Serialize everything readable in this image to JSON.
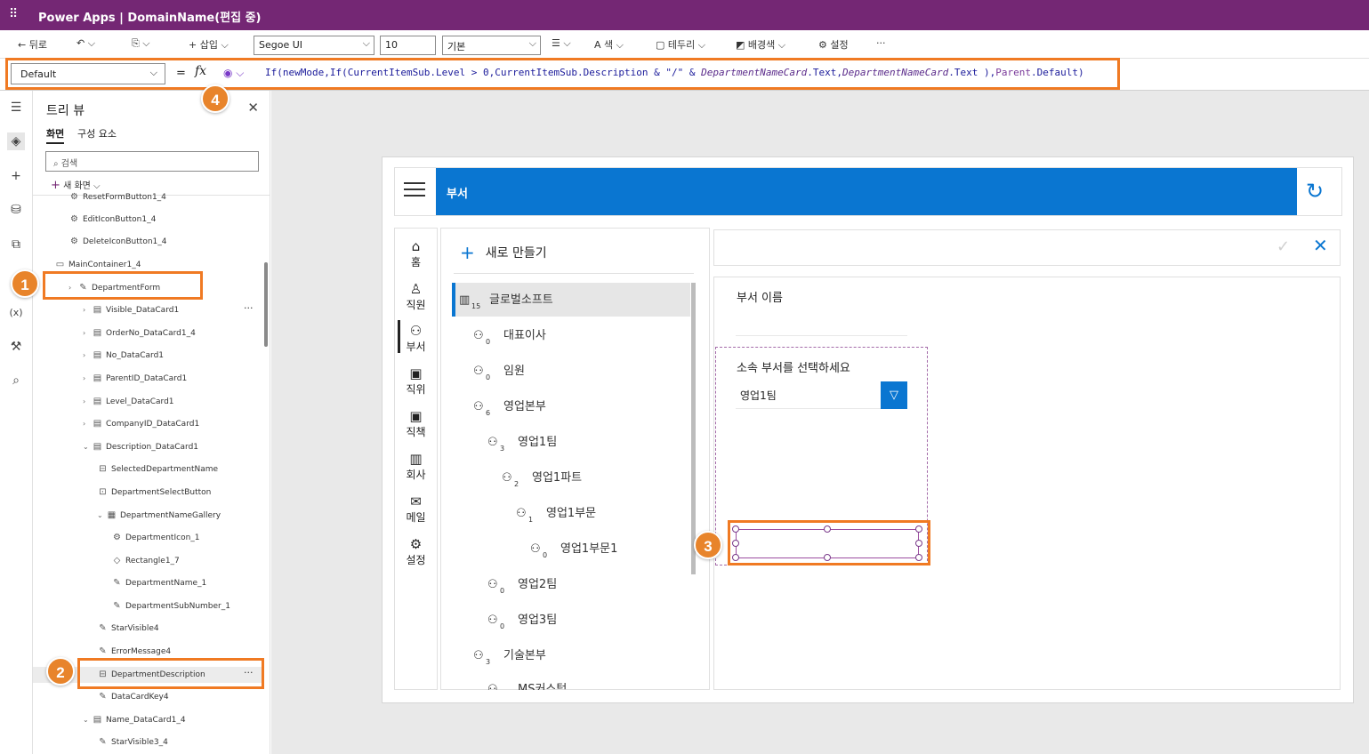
{
  "app": {
    "waffle_icon": "waffle-icon",
    "title": "Power Apps  |  DomainName(편집 중)"
  },
  "toolbar": {
    "back_label": "뒤로",
    "insert_label": "삽입",
    "font_family": "Segoe UI",
    "font_size": "10",
    "font_weight": "기본",
    "color_label": "색",
    "border_label": "테두리",
    "fill_label": "배경색",
    "settings_label": "설정",
    "more": "···"
  },
  "formula_bar": {
    "property": "Default",
    "equals": "=",
    "fx": "fx",
    "formula_parts": [
      {
        "t": "If(newMode,If(CurrentItemSub.Level > 0,CurrentItemSub.Description & \"/\" & ",
        "c": "kw"
      },
      {
        "t": "DepartmentNameCard",
        "c": "it"
      },
      {
        "t": ".Text,",
        "c": "kw"
      },
      {
        "t": "DepartmentNameCard",
        "c": "it"
      },
      {
        "t": ".Text ),",
        "c": "kw"
      },
      {
        "t": "Parent",
        "c": "pu"
      },
      {
        "t": ".Default)",
        "c": "kw"
      }
    ]
  },
  "badges": [
    "1",
    "2",
    "3",
    "4"
  ],
  "tree_view": {
    "title": "트리 뷰",
    "tabs": [
      "화면",
      "구성 요소"
    ],
    "search_placeholder": "검색",
    "new_screen": "새 화면",
    "items": [
      {
        "label": "ResetFormButton1_4",
        "icon": "⚙"
      },
      {
        "label": "EditIconButton1_4",
        "icon": "⚙"
      },
      {
        "label": "DeleteIconButton1_4",
        "icon": "⚙"
      },
      {
        "label": "MainContainer1_4",
        "icon": "▭"
      },
      {
        "label": "DepartmentForm",
        "icon": "✎"
      },
      {
        "label": "Visible_DataCard1",
        "icon": "▤"
      },
      {
        "label": "OrderNo_DataCard1_4",
        "icon": "▤"
      },
      {
        "label": "No_DataCard1",
        "icon": "▤"
      },
      {
        "label": "ParentID_DataCard1",
        "icon": "▤"
      },
      {
        "label": "Level_DataCard1",
        "icon": "▤"
      },
      {
        "label": "CompanyID_DataCard1",
        "icon": "▤"
      },
      {
        "label": "Description_DataCard1",
        "icon": "▤"
      },
      {
        "label": "SelectedDepartmentName",
        "icon": "⊟"
      },
      {
        "label": "DepartmentSelectButton",
        "icon": "⊡"
      },
      {
        "label": "DepartmentNameGallery",
        "icon": "▦"
      },
      {
        "label": "DepartmentIcon_1",
        "icon": "⚙"
      },
      {
        "label": "Rectangle1_7",
        "icon": "◇"
      },
      {
        "label": "DepartmentName_1",
        "icon": "✎"
      },
      {
        "label": "DepartmentSubNumber_1",
        "icon": "✎"
      },
      {
        "label": "StarVisible4",
        "icon": "✎"
      },
      {
        "label": "ErrorMessage4",
        "icon": "✎"
      },
      {
        "label": "DepartmentDescription",
        "icon": "⊟"
      },
      {
        "label": "DataCardKey4",
        "icon": "✎"
      },
      {
        "label": "Name_DataCard1_4",
        "icon": "▤"
      },
      {
        "label": "StarVisible3_4",
        "icon": "✎"
      }
    ]
  },
  "app_header": {
    "title": "부서"
  },
  "nav": [
    {
      "icon": "⌂",
      "label": "홈"
    },
    {
      "icon": "♙",
      "label": "직원"
    },
    {
      "icon": "⚇",
      "label": "부서"
    },
    {
      "icon": "▣",
      "label": "직위"
    },
    {
      "icon": "▣",
      "label": "직책"
    },
    {
      "icon": "▥",
      "label": "회사"
    },
    {
      "icon": "✉",
      "label": "메일"
    },
    {
      "icon": "⚙",
      "label": "설정"
    }
  ],
  "list": {
    "new_label": "새로 만들기",
    "items": [
      {
        "label": "글로벌소프트",
        "count": "15"
      },
      {
        "label": "대표이사",
        "count": "0"
      },
      {
        "label": "임원",
        "count": "0"
      },
      {
        "label": "영업본부",
        "count": "6"
      },
      {
        "label": "영업1팀",
        "count": "3"
      },
      {
        "label": "영업1파트",
        "count": "2"
      },
      {
        "label": "영업1부문",
        "count": "1"
      },
      {
        "label": "영업1부문1",
        "count": "0"
      },
      {
        "label": "영업2팀",
        "count": "0"
      },
      {
        "label": "영업3팀",
        "count": "0"
      },
      {
        "label": "기술본부",
        "count": "3"
      },
      {
        "label": "MS커스텀",
        "count": ""
      }
    ]
  },
  "form": {
    "name_label": "부서 이름",
    "parent_label": "소속 부서를 선택하세요",
    "parent_value": "영업1팀"
  }
}
